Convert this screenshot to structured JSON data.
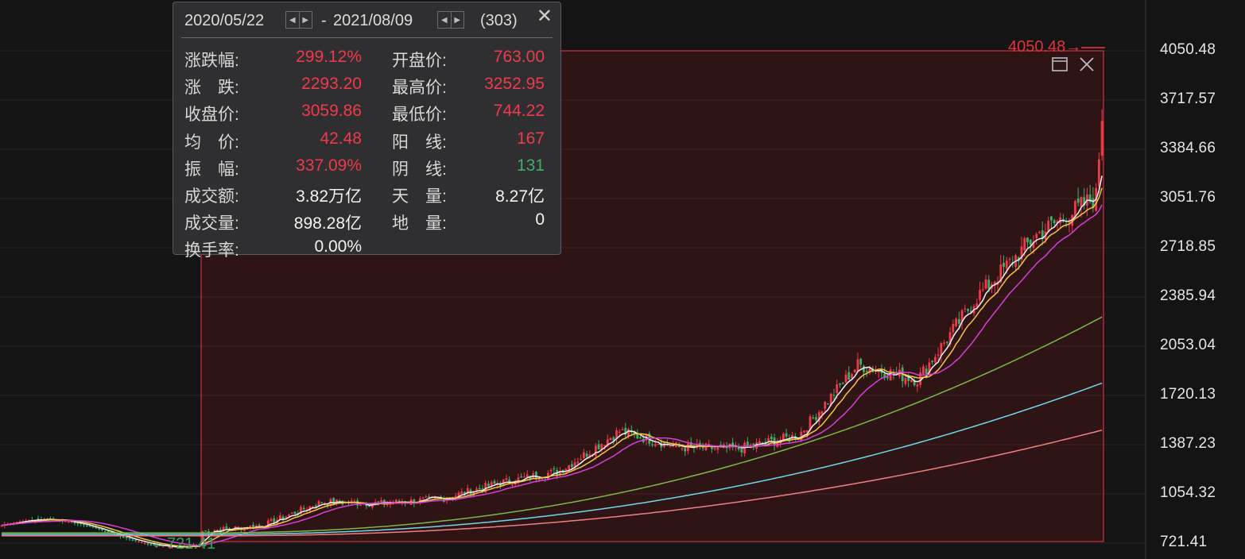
{
  "info_panel": {
    "start_date": "2020/05/22",
    "end_date": "2021/08/09",
    "date_sep": "-",
    "count": "(303)",
    "rows": [
      {
        "l1": "涨跌幅:",
        "v1": "299.12%",
        "c1": "red",
        "l2": "开盘价:",
        "v2": "763.00",
        "c2": "red"
      },
      {
        "l1": "涨　跌:",
        "v1": "2293.20",
        "c1": "red",
        "l2": "最高价:",
        "v2": "3252.95",
        "c2": "red"
      },
      {
        "l1": "收盘价:",
        "v1": "3059.86",
        "c1": "red",
        "l2": "最低价:",
        "v2": "744.22",
        "c2": "red"
      },
      {
        "l1": "均　价:",
        "v1": "42.48",
        "c1": "red",
        "l2": "阳　线:",
        "v2": "167",
        "c2": "red"
      },
      {
        "l1": "振　幅:",
        "v1": "337.09%",
        "c1": "red",
        "l2": "阴　线:",
        "v2": "131",
        "c2": "green"
      },
      {
        "l1": "成交额:",
        "v1": "3.82万亿",
        "c1": "white",
        "l2": "天　量:",
        "v2": "8.27亿",
        "c2": "white"
      },
      {
        "l1": "成交量:",
        "v1": "898.28亿",
        "c1": "white",
        "l2": "地　量:",
        "v2": "0",
        "c2": "white"
      },
      {
        "l1": "换手率:",
        "v1": "0.00%",
        "c1": "white",
        "l2": "",
        "v2": "",
        "c2": "white"
      }
    ]
  },
  "icons": {
    "close": "close-icon",
    "restore": "window-restore-icon",
    "prev": "arrow-left-icon",
    "next": "arrow-right-icon"
  },
  "colors": {
    "up": "#f0394a",
    "down": "#3fae6a",
    "ma5": "#f2f2f2",
    "ma10": "#f5c542",
    "ma20": "#d63fd6",
    "ma60": "#7bb84a",
    "ma120": "#6fd8e8",
    "ma250": "#f08080"
  },
  "chart_data": {
    "type": "candlestick",
    "y_axis_labels": [
      "4050.48",
      "3717.57",
      "3384.66",
      "3051.76",
      "2718.85",
      "2385.94",
      "2053.04",
      "1720.13",
      "1387.23",
      "1054.32",
      "721.41"
    ],
    "ylim": [
      721.41,
      4050.48
    ],
    "high_label": "4050.48",
    "low_label": "721.41",
    "high_arrow": "→",
    "low_arrow": "←",
    "grid": true,
    "selection": {
      "start": "2020/05/22",
      "end": "2021/08/09",
      "bars": 303
    },
    "series": [
      {
        "name": "close",
        "x": [
          0,
          20,
          40,
          60,
          80,
          100,
          120,
          140,
          160,
          180,
          200,
          220,
          240,
          260,
          280,
          300,
          303
        ],
        "values": [
          790,
          830,
          990,
          980,
          1010,
          1120,
          1200,
          1470,
          1360,
          1350,
          1440,
          1920,
          1820,
          2380,
          2800,
          3060,
          3900
        ]
      },
      {
        "name": "MA60-like",
        "x": [
          0,
          303
        ],
        "values": [
          780,
          2250
        ]
      },
      {
        "name": "MA120-like",
        "x": [
          0,
          303
        ],
        "values": [
          770,
          1800
        ]
      },
      {
        "name": "MA250-like",
        "x": [
          0,
          303
        ],
        "values": [
          760,
          1480
        ]
      }
    ]
  }
}
